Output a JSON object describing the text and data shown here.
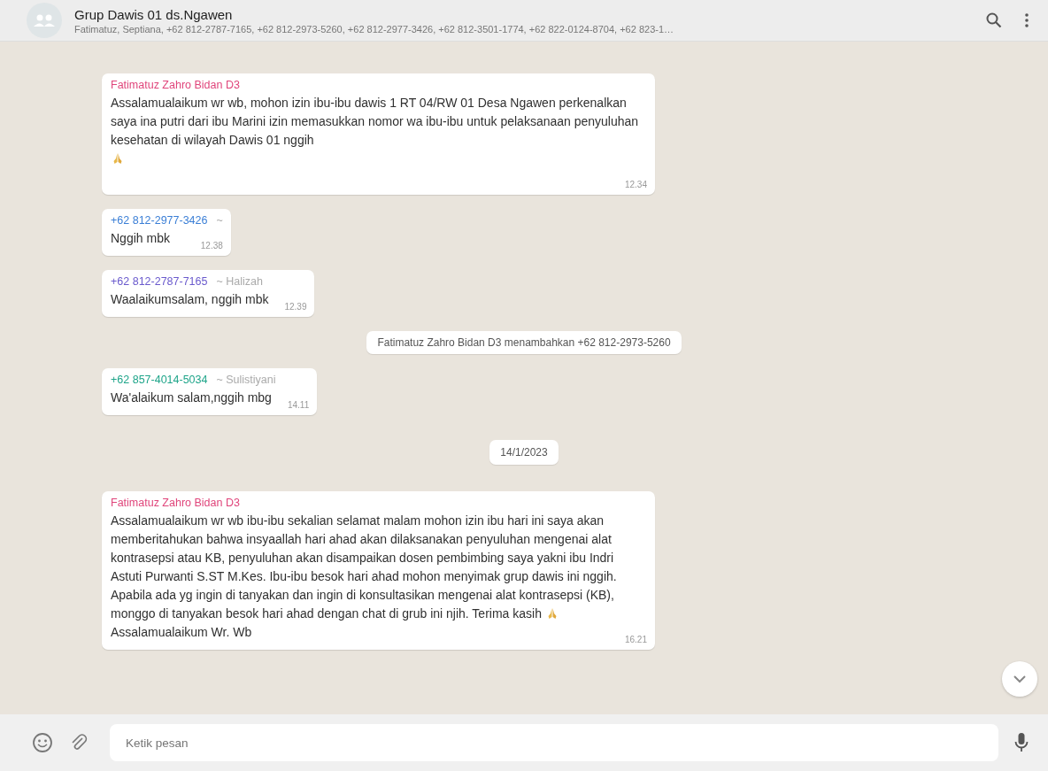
{
  "header": {
    "title": "Grup Dawis 01 ds.Ngawen",
    "subtitle": "Fatimatuz, Septiana, +62 812-2787-7165, +62 812-2973-5260, +62 812-2977-3426, +62 812-3501-1774, +62 822-0124-8704, +62 823-1…"
  },
  "messages": [
    {
      "kind": "message",
      "sender": "Fatimatuz Zahro Bidan D3",
      "color": "#e0457b",
      "text": "Assalamualaikum wr wb, mohon izin ibu-ibu dawis 1 RT 04/RW 01 Desa Ngawen perkenalkan saya ina putri dari ibu Marini izin memasukkan nomor wa ibu-ibu untuk pelaksanaan penyuluhan kesehatan di wilayah Dawis 01 nggih",
      "pray": true,
      "pray_newline": true,
      "time": "12.34"
    },
    {
      "kind": "message",
      "sender": "+62 812-2977-3426",
      "color": "#3b7fd6",
      "pushname": "~",
      "text": "Nggih mbk",
      "pray": false,
      "time": "12.38"
    },
    {
      "kind": "message",
      "sender": "+62 812-2787-7165",
      "color": "#6a5acd",
      "pushname": "~ Halizah",
      "text": "Waalaikumsalam, nggih mbk",
      "pray": false,
      "time": "12.39"
    },
    {
      "kind": "system",
      "text": "Fatimatuz Zahro Bidan D3 menambahkan +62 812-2973-5260"
    },
    {
      "kind": "message",
      "sender": "+62 857-4014-5034",
      "color": "#1fa58a",
      "pushname": "~ Sulistiyani",
      "text": "Wa'alaikum salam,nggih mbg",
      "pray": false,
      "time": "14.11"
    },
    {
      "kind": "date",
      "text": "14/1/2023"
    },
    {
      "kind": "message",
      "sender": "Fatimatuz Zahro Bidan D3",
      "color": "#e0457b",
      "text": "Assalamualaikum wr wb ibu-ibu sekalian selamat malam mohon izin ibu hari ini saya akan memberitahukan bahwa insyaallah hari ahad akan dilaksanakan penyuluhan mengenai alat kontrasepsi atau KB, penyuluhan akan disampaikan dosen pembimbing saya yakni ibu Indri Astuti Purwanti S.ST M.Kes. Ibu-ibu besok hari ahad mohon menyimak grup dawis ini nggih. Apabila ada yg ingin di tanyakan dan ingin di konsultasikan mengenai alat kontrasepsi (KB), monggo di tanyakan besok hari ahad dengan chat di grub ini njih. Terima kasih",
      "pray": true,
      "pray_newline": false,
      "after": "Assalamualaikum Wr. Wb",
      "time": "16.21"
    }
  ],
  "composer": {
    "placeholder": "Ketik pesan"
  }
}
